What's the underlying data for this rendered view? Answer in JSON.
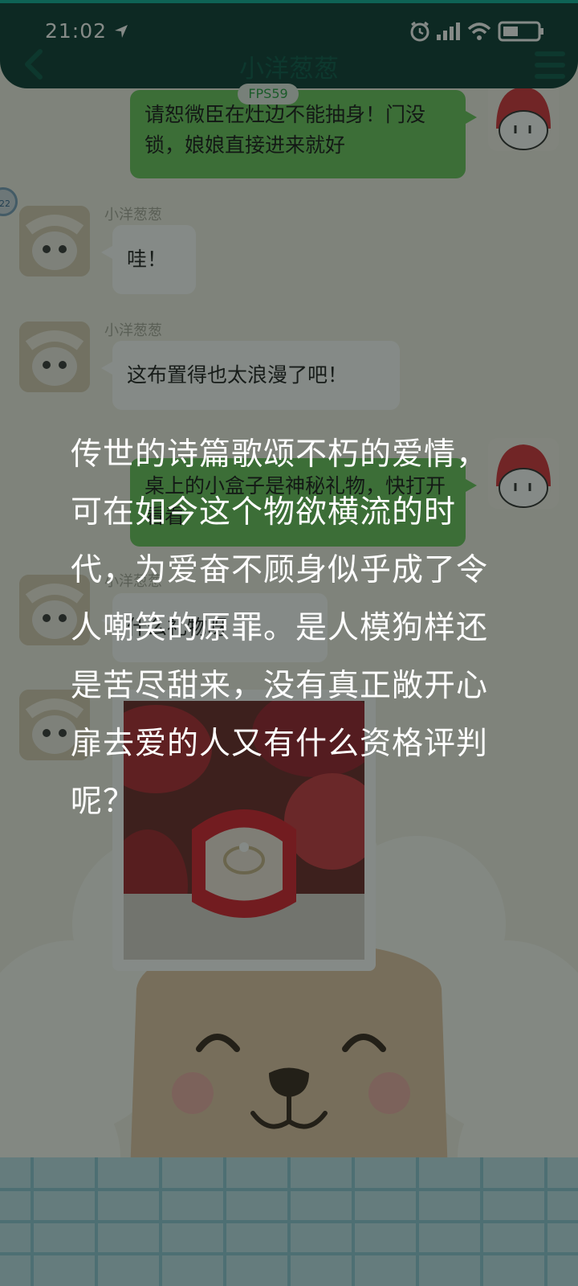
{
  "status_bar": {
    "time": "21:02"
  },
  "header": {
    "title": "小洋葱葱"
  },
  "fps_badge": "FPS59",
  "side_badge": "22",
  "messages": [
    {
      "side": "out",
      "text": "请恕微臣在灶边不能抽身！门没锁，娘娘直接进来就好"
    },
    {
      "side": "in",
      "sender": "小洋葱葱",
      "text": "哇！"
    },
    {
      "side": "in",
      "sender": "小洋葱葱",
      "text": "这布置得也太浪漫了吧！"
    },
    {
      "side": "out",
      "text": "桌上的小盒子是神秘礼物，快打开看看"
    },
    {
      "side": "in",
      "sender": "小洋葱葱",
      "text": "什么礼物呀"
    }
  ],
  "overlay_text": "传世的诗篇歌颂不朽的爱情，可在如今这个物欲横流的时代，为爱奋不顾身似乎成了令人嘲笑的原罪。是人模狗样还是苦尽甜来，没有真正敞开心扉去爱的人又有什么资格评判呢？",
  "colors": {
    "header": "#0e3d36",
    "accent": "#10b09a",
    "bubble_out": "#6cc75f",
    "bubble_in": "#ffffff"
  },
  "icons": [
    "location-arrow-icon",
    "alarm-icon",
    "signal-icon",
    "wifi-icon",
    "battery-icon",
    "back-chevron-icon",
    "menu-icon"
  ]
}
